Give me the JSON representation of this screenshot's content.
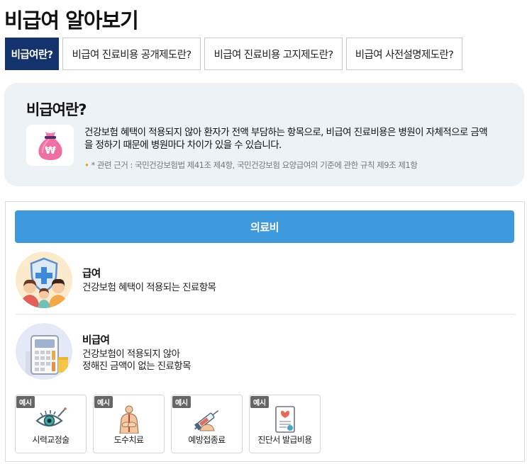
{
  "page": {
    "title": "비급여 알아보기"
  },
  "tabs": [
    {
      "label": "비급여란?"
    },
    {
      "label": "비급여 진료비용 공개제도란?"
    },
    {
      "label": "비급여 진료비용 고지제도란?"
    },
    {
      "label": "비급여 사전설명제도란?"
    }
  ],
  "intro": {
    "title": "비급여란?",
    "icon": "money-bag-icon",
    "description_line1": "건강보험 혜택이 적용되지 않아 환자가 전액 부담하는 항목으로, 비급여 진료비용은 병원이 자체적으로 금액",
    "description_line2": "을 정하기 때문에 병원마다 차이가 있을 수 있습니다.",
    "reference_bullet": "•",
    "reference": "* 관련 근거 : 국민건강보험법 제41조 제4항, 국민건강보험 요양급여의 기준에 관한 규칙 제9조 제1항"
  },
  "medical_cost": {
    "bar_label": "의료비",
    "covered": {
      "icon": "family-shield-icon",
      "title": "급여",
      "description": "건강보험 혜택이 적용되는 진료항목"
    },
    "non_covered": {
      "icon": "calculator-icon",
      "title": "비급여",
      "description_line1": "건강보험이 적용되지 않아",
      "description_line2": "정해진 금액이 없는 진료항목"
    },
    "examples": [
      {
        "badge": "예시",
        "label": "시력교정술",
        "icon": "eye-surgery-icon"
      },
      {
        "badge": "예시",
        "label": "도수치료",
        "icon": "manual-therapy-icon"
      },
      {
        "badge": "예시",
        "label": "예방접종료",
        "icon": "syringe-icon"
      },
      {
        "badge": "예시",
        "label": "진단서 발급비용",
        "icon": "certificate-icon"
      }
    ]
  },
  "colors": {
    "active_tab": "#14326b",
    "info_bg": "#ecf2f6",
    "bar": "#3d99dc",
    "badge": "#666666"
  }
}
